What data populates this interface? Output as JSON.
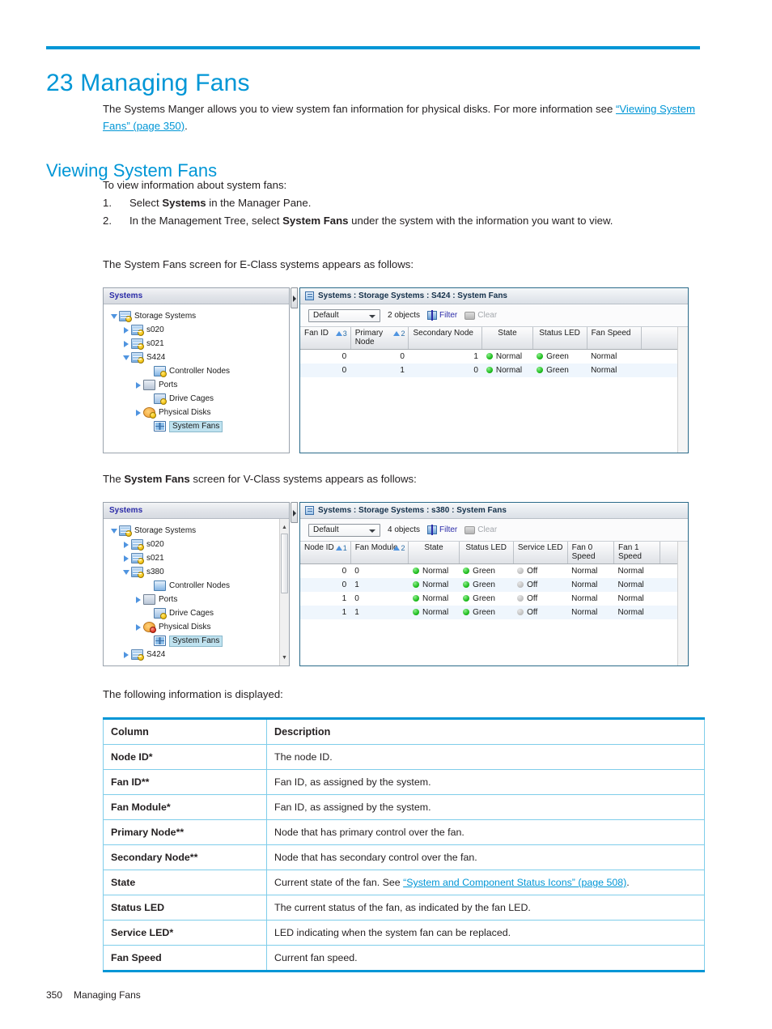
{
  "chapter": {
    "number": "23",
    "title": "23 Managing Fans"
  },
  "intro": {
    "text_before": "The Systems Manger allows you to view system fan information for physical disks. For more information see ",
    "link": "“Viewing System Fans” (page 350)",
    "text_after": "."
  },
  "section": {
    "title": "Viewing System Fans",
    "lead": "To view information about system fans:",
    "steps": [
      {
        "num": "1.",
        "before": "Select ",
        "bold": "Systems",
        "after": " in the Manager Pane."
      },
      {
        "num": "2.",
        "before": "In the Management Tree, select ",
        "bold": "System Fans",
        "after": " under the system with the information you want to view."
      }
    ],
    "caption_eclass_before": "The System Fans screen for E-Class systems appears as follows:",
    "caption_vclass_before": "The ",
    "caption_vclass_bold": "System Fans",
    "caption_vclass_after": " screen for V-Class systems appears as follows:",
    "caption_following": "The following information is displayed:"
  },
  "screenshot_eclass": {
    "tree": {
      "header": "Systems",
      "nodes": [
        {
          "label": "Storage Systems",
          "indent": 0,
          "twisty": "open",
          "icon": "server-icon",
          "badge": "warning",
          "selected": false
        },
        {
          "label": "s020",
          "indent": 1,
          "twisty": "closed",
          "icon": "server-icon",
          "badge": "warning",
          "selected": false
        },
        {
          "label": "s021",
          "indent": 1,
          "twisty": "closed",
          "icon": "server-icon",
          "badge": "warning",
          "selected": false
        },
        {
          "label": "S424",
          "indent": 1,
          "twisty": "open",
          "icon": "server-icon",
          "badge": "warning",
          "selected": false
        },
        {
          "label": "Controller Nodes",
          "indent": 2,
          "twisty": "none",
          "icon": "controller-node-icon",
          "badge": "warning",
          "selected": false
        },
        {
          "label": "Ports",
          "indent": 2,
          "twisty": "closed",
          "icon": "ports-icon",
          "badge": "none",
          "selected": false
        },
        {
          "label": "Drive Cages",
          "indent": 2,
          "twisty": "none",
          "icon": "drive-cage-icon",
          "badge": "warning",
          "selected": false
        },
        {
          "label": "Physical Disks",
          "indent": 2,
          "twisty": "closed",
          "icon": "physical-disk-icon",
          "badge": "warning",
          "selected": false
        },
        {
          "label": "System Fans",
          "indent": 2,
          "twisty": "none",
          "icon": "system-fan-icon",
          "badge": "none",
          "selected": true
        }
      ]
    },
    "panel": {
      "title": "Systems : Storage Systems : S424 : System Fans",
      "toolbar": {
        "view_selected": "Default",
        "object_count": "2 objects",
        "filter_label": "Filter",
        "clear_label": "Clear"
      },
      "columns": [
        {
          "label": "Fan ID",
          "sort": "3",
          "align": "left",
          "width": "13%"
        },
        {
          "label": "Primary Node",
          "sort": "2",
          "align": "left",
          "width": "15%"
        },
        {
          "label": "Secondary Node",
          "sort": "",
          "align": "left",
          "width": "18%"
        },
        {
          "label": "State",
          "sort": "",
          "align": "center",
          "width": "13%"
        },
        {
          "label": "Status LED",
          "sort": "",
          "align": "center",
          "width": "14%"
        },
        {
          "label": "Fan Speed",
          "sort": "",
          "align": "left",
          "width": "14%"
        },
        {
          "label": "",
          "sort": "",
          "align": "left",
          "width": "13%"
        }
      ],
      "rows": [
        {
          "fan_id": "0",
          "primary_node": "0",
          "secondary_node": "1",
          "state": "Normal",
          "state_dot": "green",
          "status_led": "Green",
          "status_dot": "green",
          "fan_speed": "Normal"
        },
        {
          "fan_id": "0",
          "primary_node": "1",
          "secondary_node": "0",
          "state": "Normal",
          "state_dot": "green",
          "status_led": "Green",
          "status_dot": "green",
          "fan_speed": "Normal"
        }
      ]
    }
  },
  "screenshot_vclass": {
    "tree": {
      "header": "Systems",
      "nodes": [
        {
          "label": "Storage Systems",
          "indent": 0,
          "twisty": "open",
          "icon": "server-icon",
          "badge": "warning",
          "selected": false
        },
        {
          "label": "s020",
          "indent": 1,
          "twisty": "closed",
          "icon": "server-icon",
          "badge": "warning",
          "selected": false
        },
        {
          "label": "s021",
          "indent": 1,
          "twisty": "closed",
          "icon": "server-icon",
          "badge": "warning",
          "selected": false
        },
        {
          "label": "s380",
          "indent": 1,
          "twisty": "open",
          "icon": "server-icon",
          "badge": "warning",
          "selected": false
        },
        {
          "label": "Controller Nodes",
          "indent": 2,
          "twisty": "none",
          "icon": "controller-node-icon",
          "badge": "none",
          "selected": false
        },
        {
          "label": "Ports",
          "indent": 2,
          "twisty": "closed",
          "icon": "ports-icon",
          "badge": "none",
          "selected": false
        },
        {
          "label": "Drive Cages",
          "indent": 2,
          "twisty": "none",
          "icon": "drive-cage-icon",
          "badge": "warning",
          "selected": false
        },
        {
          "label": "Physical Disks",
          "indent": 2,
          "twisty": "closed",
          "icon": "physical-disk-icon",
          "badge": "error",
          "selected": false
        },
        {
          "label": "System Fans",
          "indent": 2,
          "twisty": "none",
          "icon": "system-fan-icon",
          "badge": "none",
          "selected": true
        },
        {
          "label": "S424",
          "indent": 1,
          "twisty": "closed",
          "icon": "server-icon",
          "badge": "warning",
          "selected": false
        }
      ]
    },
    "panel": {
      "title": "Systems : Storage Systems : s380 : System Fans",
      "toolbar": {
        "view_selected": "Default",
        "object_count": "4 objects",
        "filter_label": "Filter",
        "clear_label": "Clear"
      },
      "columns": [
        {
          "label": "Node ID",
          "sort": "1",
          "align": "left",
          "width": "13%"
        },
        {
          "label": "Fan Module",
          "sort": "2",
          "align": "left",
          "width": "15%"
        },
        {
          "label": "State",
          "sort": "",
          "align": "center",
          "width": "13%"
        },
        {
          "label": "Status LED",
          "sort": "",
          "align": "center",
          "width": "14%"
        },
        {
          "label": "Service LED",
          "sort": "",
          "align": "center",
          "width": "14%"
        },
        {
          "label": "Fan 0 Speed",
          "sort": "",
          "align": "left",
          "width": "12%"
        },
        {
          "label": "Fan 1 Speed",
          "sort": "",
          "align": "left",
          "width": "12%"
        },
        {
          "label": "",
          "sort": "",
          "align": "left",
          "width": "7%"
        }
      ],
      "rows": [
        {
          "node_id": "0",
          "fan_module": "0",
          "state": "Normal",
          "state_dot": "green",
          "status_led": "Green",
          "status_dot": "green",
          "service_led": "Off",
          "service_dot": "gray",
          "fan0": "Normal",
          "fan1": "Normal"
        },
        {
          "node_id": "0",
          "fan_module": "1",
          "state": "Normal",
          "state_dot": "green",
          "status_led": "Green",
          "status_dot": "green",
          "service_led": "Off",
          "service_dot": "gray",
          "fan0": "Normal",
          "fan1": "Normal"
        },
        {
          "node_id": "1",
          "fan_module": "0",
          "state": "Normal",
          "state_dot": "green",
          "status_led": "Green",
          "status_dot": "green",
          "service_led": "Off",
          "service_dot": "gray",
          "fan0": "Normal",
          "fan1": "Normal"
        },
        {
          "node_id": "1",
          "fan_module": "1",
          "state": "Normal",
          "state_dot": "green",
          "status_led": "Green",
          "status_dot": "green",
          "service_led": "Off",
          "service_dot": "gray",
          "fan0": "Normal",
          "fan1": "Normal"
        }
      ]
    }
  },
  "description_table": {
    "headers": [
      "Column",
      "Description"
    ],
    "rows": [
      {
        "column": "Node ID*",
        "description": "The node ID."
      },
      {
        "column": "Fan ID**",
        "description": "Fan ID, as assigned by the system."
      },
      {
        "column": "Fan Module*",
        "description": "Fan ID, as assigned by the system."
      },
      {
        "column": "Primary Node**",
        "description": "Node that has primary control over the fan."
      },
      {
        "column": "Secondary Node**",
        "description": "Node that has secondary control over the fan."
      },
      {
        "column": "State",
        "description": "Current state of the fan. See ",
        "link": "“System and Component Status Icons” (page 508)",
        "description_after": "."
      },
      {
        "column": "Status LED",
        "description": "The current status of the fan, as indicated by the fan LED."
      },
      {
        "column": "Service LED*",
        "description": "LED indicating when the system fan can be replaced."
      },
      {
        "column": "Fan Speed",
        "description": "Current fan speed."
      }
    ]
  },
  "footer": {
    "page_number": "350",
    "chapter_name": "Managing Fans"
  },
  "colors": {
    "accent": "#0096d6",
    "link": "#0096d6",
    "text": "#231f20",
    "status_green": "#12b512",
    "status_gray": "#bdbdbd"
  }
}
